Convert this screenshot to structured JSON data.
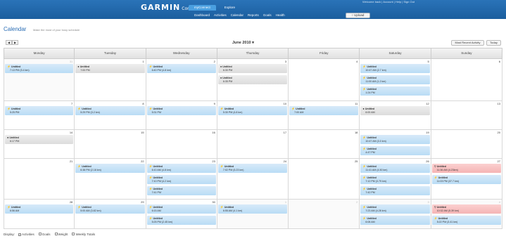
{
  "header": {
    "logo": "GARMIN",
    "logo_sub": "Connect",
    "top_links": "Welcome back  |  Account  |  Help  |  Sign Out",
    "tabs": [
      "myConnect",
      "Explore"
    ],
    "subnav": [
      "Dashboard",
      "Activities",
      "Calendar",
      "Reports",
      "Goals",
      "Health"
    ],
    "upload_label": "Upload",
    "colors": {
      "bar": "#1b5e9e",
      "active_tab": "#4a9fe0"
    }
  },
  "page": {
    "title": "Calendar",
    "subtitle": "Make the most of your busy schedule"
  },
  "toolbar": {
    "prev": "◀",
    "next": "▶",
    "month": "June 2010",
    "recent_label": "Most Recent Activity",
    "today_label": "Today"
  },
  "calendar": {
    "weekdays": [
      "Monday",
      "Tuesday",
      "Wednesday",
      "Thursday",
      "Friday",
      "Saturday",
      "Sunday"
    ],
    "weeks": [
      {
        "height": 60,
        "days": [
          {
            "num": "31",
            "other": true,
            "events": [
              {
                "type": "blue",
                "icon": "run",
                "title": "Untitled",
                "time": "7:13 PM (5.4 km)"
              }
            ]
          },
          {
            "num": "1",
            "events": [
              {
                "type": "gray",
                "icon": "dot",
                "title": "Untitled",
                "time": "7:00 PM"
              }
            ]
          },
          {
            "num": "2",
            "events": [
              {
                "type": "blue",
                "icon": "run",
                "title": "Untitled",
                "time": "6:40 PM (4.8 km)"
              }
            ]
          },
          {
            "num": "3",
            "events": [
              {
                "type": "gray",
                "icon": "dot",
                "title": "Untitled",
                "time": "6:30 PM"
              },
              {
                "type": "gray",
                "icon": "dot",
                "title": "Untitled",
                "time": "6:35 PM"
              }
            ]
          },
          {
            "num": "4",
            "events": []
          },
          {
            "num": "5",
            "events": [
              {
                "type": "blue",
                "icon": "run",
                "title": "Untitled",
                "time": "10:47 AM (2.7 km)"
              },
              {
                "type": "blue",
                "icon": "run",
                "title": "Untitled",
                "time": "11:00 AM (1.2 km)"
              },
              {
                "type": "blue",
                "icon": "run",
                "title": "Untitled",
                "time": "1:24 PM"
              }
            ]
          },
          {
            "num": "6",
            "events": []
          }
        ]
      },
      {
        "height": 41,
        "days": [
          {
            "num": "7",
            "events": [
              {
                "type": "blue",
                "icon": "run",
                "title": "Untitled",
                "time": "5:25 PM"
              }
            ]
          },
          {
            "num": "8",
            "events": [
              {
                "type": "blue",
                "icon": "run",
                "title": "Untitled",
                "time": "5:29 PM (3.2 km)"
              }
            ]
          },
          {
            "num": "9",
            "events": [
              {
                "type": "blue",
                "icon": "run",
                "title": "Untitled",
                "time": "5:31 PM"
              }
            ]
          },
          {
            "num": "10",
            "events": [
              {
                "type": "blue",
                "icon": "run",
                "title": "Untitled",
                "time": "5:30 PM (4.8 km)"
              }
            ]
          },
          {
            "num": "11",
            "events": [
              {
                "type": "blue",
                "icon": "run",
                "title": "Untitled",
                "time": "7:00 AM"
              }
            ]
          },
          {
            "num": "12",
            "events": [
              {
                "type": "gray",
                "icon": "dot",
                "title": "Untitled",
                "time": "6:00 AM"
              }
            ]
          },
          {
            "num": "13",
            "events": []
          }
        ]
      },
      {
        "height": 41,
        "days": [
          {
            "num": "14",
            "events": [
              {
                "type": "gray",
                "icon": "dot",
                "title": "Untitled",
                "time": "6:17 PM"
              }
            ]
          },
          {
            "num": "15",
            "events": []
          },
          {
            "num": "16",
            "events": []
          },
          {
            "num": "17",
            "events": []
          },
          {
            "num": "18",
            "events": []
          },
          {
            "num": "19",
            "events": [
              {
                "type": "blue",
                "icon": "run",
                "title": "Untitled",
                "time": "10:47 AM (3.0 km)"
              },
              {
                "type": "blue",
                "icon": "run",
                "title": "Untitled",
                "time": "4:47 PM"
              }
            ]
          },
          {
            "num": "20",
            "events": []
          }
        ]
      },
      {
        "height": 58,
        "days": [
          {
            "num": "21",
            "events": []
          },
          {
            "num": "22",
            "events": [
              {
                "type": "blue",
                "icon": "run",
                "title": "Untitled",
                "time": "6:38 PM (2.18 km)"
              }
            ]
          },
          {
            "num": "23",
            "events": [
              {
                "type": "blue",
                "icon": "run",
                "title": "Untitled",
                "time": "6:10 AM (4.8 km)"
              },
              {
                "type": "blue",
                "icon": "run",
                "title": "Untitled",
                "time": "7:10 PM (4.2 km)"
              },
              {
                "type": "blue",
                "icon": "run",
                "title": "Untitled",
                "time": "7:41 PM"
              }
            ]
          },
          {
            "num": "24",
            "events": [
              {
                "type": "blue",
                "icon": "run",
                "title": "Untitled",
                "time": "7:02 PM (5.23 km)"
              }
            ]
          },
          {
            "num": "25",
            "events": []
          },
          {
            "num": "26",
            "events": [
              {
                "type": "blue",
                "icon": "run",
                "title": "Untitled",
                "time": "11:41 AM (4.50 km)"
              },
              {
                "type": "blue",
                "icon": "run",
                "title": "Untitled",
                "time": "7:12 PM (3.79 km)"
              },
              {
                "type": "blue",
                "icon": "run",
                "title": "Untitled",
                "time": "7:42 PM"
              }
            ]
          },
          {
            "num": "27",
            "events": [
              {
                "type": "red",
                "icon": "bike",
                "title": "Untitled",
                "time": "11:36 AM (4.23km)"
              },
              {
                "type": "blue",
                "icon": "run",
                "title": "Untitled",
                "time": "11:03 PM (37.7 km)"
              }
            ]
          }
        ]
      },
      {
        "height": 42,
        "days": [
          {
            "num": "28",
            "events": [
              {
                "type": "blue",
                "icon": "run",
                "title": "Untitled",
                "time": "6:56 AM"
              }
            ]
          },
          {
            "num": "29",
            "events": [
              {
                "type": "blue",
                "icon": "run",
                "title": "Untitled",
                "time": "5:00 AM (3.82 km)"
              }
            ]
          },
          {
            "num": "30",
            "events": [
              {
                "type": "blue",
                "icon": "run",
                "title": "Untitled",
                "time": "6:15 AM"
              },
              {
                "type": "blue",
                "icon": "run",
                "title": "Untitled",
                "time": "5:25 PM (2.45 km)"
              }
            ]
          },
          {
            "num": "1",
            "other": true,
            "events": [
              {
                "type": "blue",
                "icon": "run",
                "title": "Untitled",
                "time": "6:55 AM (4.1 km)"
              }
            ]
          },
          {
            "num": "2",
            "other": true,
            "events": []
          },
          {
            "num": "3",
            "other": true,
            "events": [
              {
                "type": "blue",
                "icon": "run",
                "title": "Untitled",
                "time": "7:23 AM (4.28 km)"
              },
              {
                "type": "blue",
                "icon": "run",
                "title": "Untitled",
                "time": "6:08 AM"
              }
            ]
          },
          {
            "num": "4",
            "other": true,
            "events": [
              {
                "type": "red",
                "icon": "bike",
                "title": "Untitled",
                "time": "10:32 AM (5.39 km)"
              },
              {
                "type": "blue",
                "icon": "run",
                "title": "Untitled",
                "time": "5:22 PM (3.41 km)"
              }
            ]
          }
        ]
      }
    ]
  },
  "icons": {
    "run": "⚡",
    "dot": "●",
    "bike": "⚲"
  },
  "display": {
    "label": "Display:",
    "options": [
      {
        "label": "Activities",
        "checked": true
      },
      {
        "label": "Goals",
        "checked": false
      },
      {
        "label": "Weight",
        "checked": false
      },
      {
        "label": "Weekly Totals",
        "checked": false
      }
    ]
  }
}
